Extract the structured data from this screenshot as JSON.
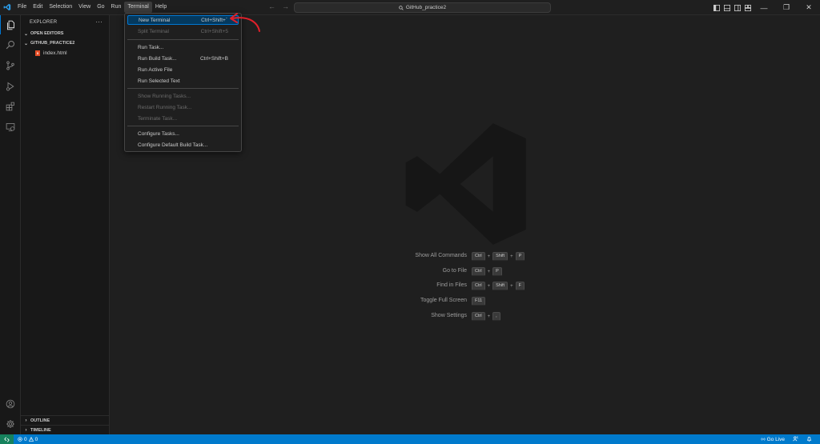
{
  "menubar": {
    "items": [
      "File",
      "Edit",
      "Selection",
      "View",
      "Go",
      "Run",
      "Terminal",
      "Help"
    ],
    "active": "Terminal"
  },
  "command_center": {
    "label": "GitHub_practice2"
  },
  "sidebar": {
    "title": "EXPLORER",
    "more": "···",
    "open_editors": "OPEN EDITORS",
    "folder": "GITHUB_PRACTICE2",
    "file": "index.html",
    "file_icon_text": "5",
    "outline": "OUTLINE",
    "timeline": "TIMELINE"
  },
  "terminal_menu": {
    "new_terminal": {
      "label": "New Terminal",
      "shortcut": "Ctrl+Shift+`"
    },
    "split_terminal": {
      "label": "Split Terminal",
      "shortcut": "Ctrl+Shift+5"
    },
    "run_task": {
      "label": "Run Task..."
    },
    "run_build_task": {
      "label": "Run Build Task...",
      "shortcut": "Ctrl+Shift+B"
    },
    "run_active_file": {
      "label": "Run Active File"
    },
    "run_selected_text": {
      "label": "Run Selected Text"
    },
    "show_running_tasks": {
      "label": "Show Running Tasks..."
    },
    "restart_running_task": {
      "label": "Restart Running Task..."
    },
    "terminate_task": {
      "label": "Terminate Task..."
    },
    "configure_tasks": {
      "label": "Configure Tasks..."
    },
    "configure_default_build_task": {
      "label": "Configure Default Build Task..."
    }
  },
  "welcome_shortcuts": [
    {
      "label": "Show All Commands",
      "keys": [
        "Ctrl",
        "Shift",
        "P"
      ]
    },
    {
      "label": "Go to File",
      "keys": [
        "Ctrl",
        "P"
      ]
    },
    {
      "label": "Find in Files",
      "keys": [
        "Ctrl",
        "Shift",
        "F"
      ]
    },
    {
      "label": "Toggle Full Screen",
      "keys": [
        "F11"
      ]
    },
    {
      "label": "Show Settings",
      "keys": [
        "Ctrl",
        ","
      ]
    }
  ],
  "statusbar": {
    "errors": "0",
    "warnings": "0",
    "go_live": "Go Live"
  },
  "colors": {
    "accent": "#0078d4",
    "statusbar": "#007acc",
    "remote": "#16825d",
    "annotation": "#e0202a"
  }
}
